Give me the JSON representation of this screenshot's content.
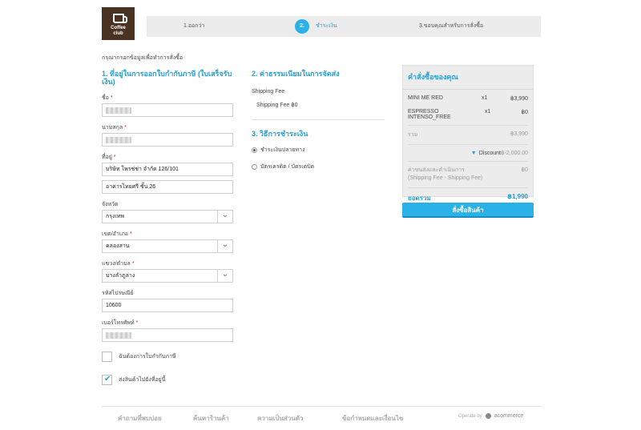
{
  "logo": {
    "line1": "Coffee",
    "line2": "club"
  },
  "steps": {
    "s1": "1.ออกว่า",
    "s2_num": "2.",
    "s2": "ชำระเงิน",
    "s3": "3.ขอบคุณสำหรับการสั่งซื้อ"
  },
  "intro": "กรุณากรอกข้อมูลเพื่อทำการสั่งซื้อ",
  "billing": {
    "title": "1. ที่อยู่ในการออกใบกำกับภาษี (ใบเสร็จรับเงิน)",
    "first_name_label": "ชื่อ",
    "last_name_label": "นามสกุล",
    "address_label": "ที่อยู่",
    "address1": "บริษัท โพรช่ช่า จำกัด 126/101",
    "address2": "อาคารไทยศรี ชั้น 26",
    "province_label": "จังหวัด",
    "province": "กรุงเทพ",
    "district_label": "เขต/อำเภอ",
    "district": "คลองสาน",
    "subdistrict_label": "แขวง/ตำบล",
    "subdistrict": "บางลำภูล่าง",
    "postcode_label": "รหัสไปรษณีย์",
    "postcode": "10600",
    "phone_label": "เบอร์โทรศัพท์",
    "tax_invoice_label": "ฉันต้องการใบกำกับภาษี",
    "same_address_label": "ส่งสินค้าไปยังที่อยู่นี้"
  },
  "shipping": {
    "title": "2. ค่าธรรมเนียมในการจัดส่ง",
    "fee_label": "Shipping Fee",
    "fee_value": "Shipping Fee ฿0"
  },
  "payment": {
    "title": "3. วิธีการชำระเงิน",
    "option1": "ชำระเงินปลายทาง",
    "option2": "บัตรเครดิต / บัตรเดบิต"
  },
  "summary": {
    "title": "คำสั่งซื้อของคุณ",
    "items": [
      {
        "name": "MINI ME RED",
        "qty": "x1",
        "price": "฿3,990"
      },
      {
        "name": "ESPRESSO INTENSO_FREE",
        "qty": "x1",
        "price": "฿0"
      }
    ],
    "subtotal_label": "รวม",
    "subtotal": "฿3,990",
    "discount_label": "Discount",
    "discount": "฿-2,000.00",
    "shipping_label": "ค่าขนส่งและดำเนินการ (Shipping Fee - Shipping Fee)",
    "shipping": "฿0",
    "total_label": "ยอดรวม",
    "total": "฿1,990"
  },
  "order_button": "สั่งซื้อสินค้า",
  "footer": {
    "faq": "คำถามที่พบบ่อย",
    "track": "ค้นหาร้านค้า",
    "privacy": "ความเป็นส่วนตัว",
    "terms": "ข้อกำหนดและเงื่อนไข",
    "operate": "Operate by",
    "brand": "acommerce"
  }
}
